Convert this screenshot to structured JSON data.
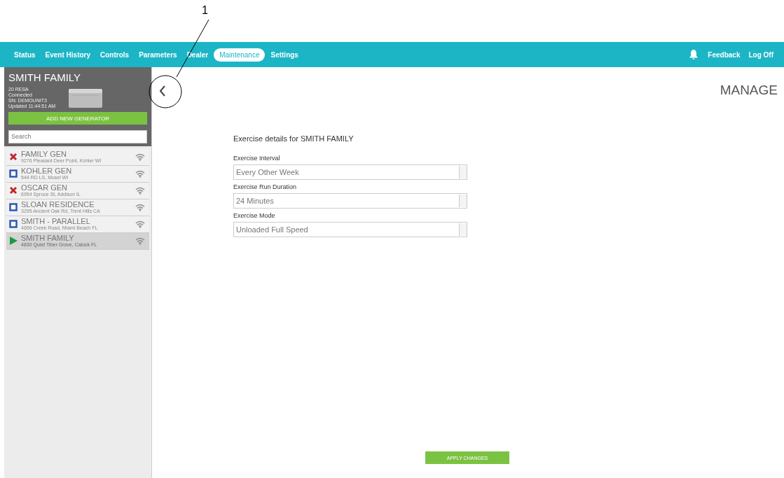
{
  "callout": {
    "label": "1"
  },
  "nav": {
    "tabs": [
      {
        "label": "Status",
        "selected": false
      },
      {
        "label": "Event History",
        "selected": false
      },
      {
        "label": "Controls",
        "selected": false
      },
      {
        "label": "Parameters",
        "selected": false
      },
      {
        "label": "Dealer",
        "selected": false
      },
      {
        "label": "Maintenance",
        "selected": true
      },
      {
        "label": "Settings",
        "selected": false
      }
    ],
    "links": [
      "Feedback",
      "Log Off"
    ]
  },
  "sidebar": {
    "generator": {
      "name": "SMITH FAMILY",
      "details": [
        "20 RESA",
        "Connected",
        "SN: DEMOUNIT3",
        "Updated 11:44:51 AM"
      ]
    },
    "add_button": "ADD NEW GENERATOR",
    "search": {
      "placeholder": "Search"
    },
    "items": [
      {
        "kind": "fault",
        "name": "FAMILY GEN",
        "address": "9276 Pleasant Deer Point, Kohler WI",
        "selected": false
      },
      {
        "kind": "stopped",
        "name": "KOHLER GEN",
        "address": "544 RD LS, Mosel  WI",
        "selected": false
      },
      {
        "kind": "fault",
        "name": "OSCAR GEN",
        "address": "6954 Spruce St, Addison IL",
        "selected": false
      },
      {
        "kind": "stopped",
        "name": "SLOAN RESIDENCE",
        "address": "3295 Ancient Oak Rd, Trent Hills CA",
        "selected": false
      },
      {
        "kind": "stopped",
        "name": "SMITH - PARALLEL",
        "address": "4656 Creek Road, Miami Beach FL",
        "selected": false
      },
      {
        "kind": "running",
        "name": "SMITH FAMILY",
        "address": "4830 Quiet Tiber Grove, Calock FL",
        "selected": true
      }
    ]
  },
  "main": {
    "heading": "MANAGE",
    "form_title": "Exercise details for SMITH FAMILY",
    "fields": [
      {
        "label": "Exercise Interval",
        "value": "Every Other Week"
      },
      {
        "label": "Exercise Run Duration",
        "value": "24 Minutes"
      },
      {
        "label": "Exercise Mode",
        "value": "Unloaded Full Speed"
      }
    ],
    "apply_button": "APPLY CHANGES"
  }
}
